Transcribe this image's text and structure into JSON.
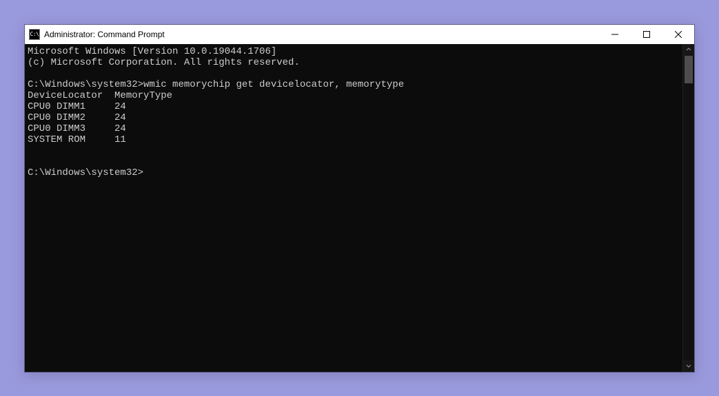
{
  "window": {
    "title": "Administrator: Command Prompt"
  },
  "terminal": {
    "header_line1": "Microsoft Windows [Version 10.0.19044.1706]",
    "header_line2": "(c) Microsoft Corporation. All rights reserved.",
    "prompt1": "C:\\Windows\\system32>",
    "command1": "wmic memorychip get devicelocator, memorytype",
    "col1_header": "DeviceLocator",
    "col2_header": "MemoryType",
    "rows": [
      {
        "locator": "CPU0 DIMM1",
        "type": "24"
      },
      {
        "locator": "CPU0 DIMM2",
        "type": "24"
      },
      {
        "locator": "CPU0 DIMM3",
        "type": "24"
      },
      {
        "locator": "SYSTEM ROM",
        "type": "11"
      }
    ],
    "prompt2": "C:\\Windows\\system32>"
  }
}
